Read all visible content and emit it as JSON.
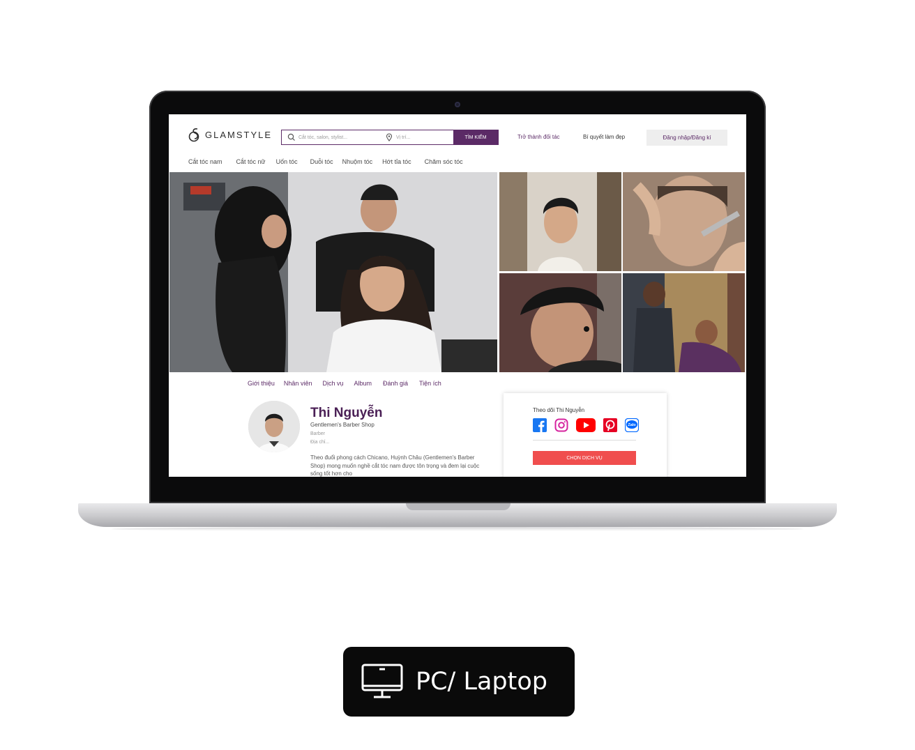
{
  "header": {
    "logo_text": "GLAMSTYLE",
    "search_placeholder": "Cắt tóc, salon, stylist...",
    "location_placeholder": "Vị trí...",
    "search_button": "TÌM KIẾM",
    "partner_link": "Trở thành đối tác",
    "beauty_tips_link": "Bí quyết làm đẹp",
    "login_button": "Đăng nhập/Đăng kí"
  },
  "nav": {
    "items": [
      "Cắt tóc nam",
      "Cắt tóc nữ",
      "Uốn tóc",
      "Duỗi tóc",
      "Nhuộm tóc",
      "Hớt tỉa tóc",
      "Chăm sóc tóc"
    ]
  },
  "tabs": {
    "items": [
      "Giới thiệu",
      "Nhân viên",
      "Dịch vụ",
      "Album",
      "Đánh giá",
      "Tiện ích"
    ]
  },
  "profile": {
    "name": "Thi Nguyễn",
    "shop": "Gentlemen's Barber Shop",
    "role": "Barber",
    "address": "Địa chỉ...",
    "bio": "Theo đuổi phong cách Chicano, Huỳnh Châu (Gentlemen's Barber Shop) mong muốn nghề cắt tóc nam được tôn trọng và đem lại cuộc sống tốt hơn cho"
  },
  "card": {
    "follow_label": "Theo dõi Thi Nguyễn",
    "socials": [
      "facebook-icon",
      "instagram-icon",
      "youtube-icon",
      "pinterest-icon",
      "zalo-icon"
    ],
    "zalo_label": "Zalo",
    "choose_button": "CHỌN DỊCH VỤ"
  },
  "badge": {
    "label": "PC/ Laptop",
    "icon": "monitor-icon"
  },
  "colors": {
    "brand": "#5b2a66",
    "accent": "#f04e4e",
    "facebook": "#1877f2",
    "instagram": "#d6249f",
    "youtube": "#ff0000",
    "pinterest": "#e60023",
    "zalo": "#0068ff"
  }
}
